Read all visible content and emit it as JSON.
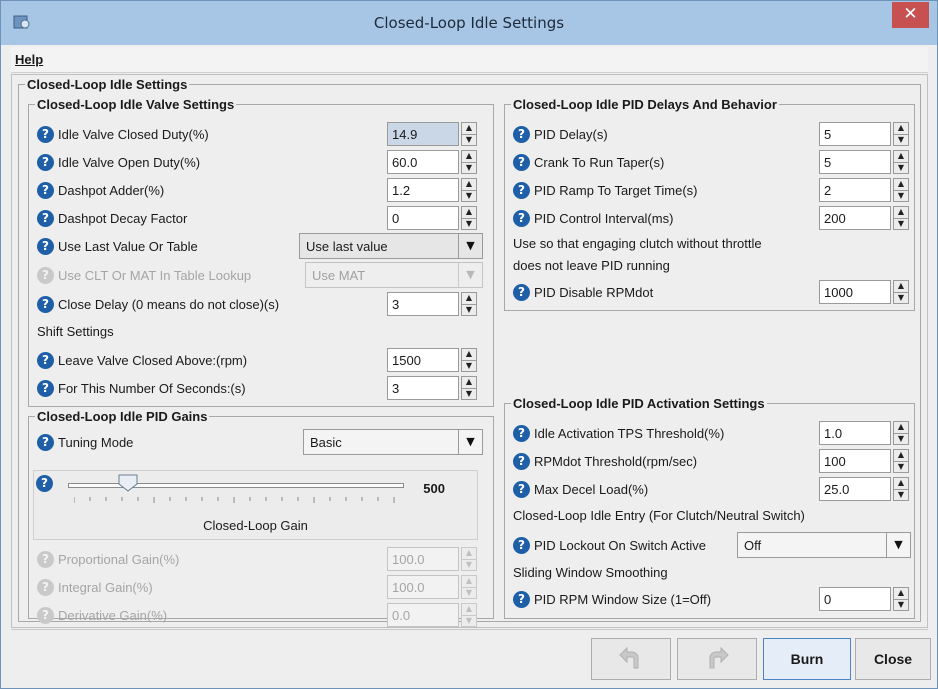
{
  "window": {
    "title": "Closed-Loop Idle Settings",
    "close_glyph": "✕"
  },
  "menu": {
    "help": "Help"
  },
  "outer_group": {
    "title": "Closed-Loop Idle Settings"
  },
  "valve": {
    "title": "Closed-Loop Idle Valve Settings",
    "closed_duty_label": "Idle Valve Closed Duty(%)",
    "closed_duty_value": "14.9",
    "open_duty_label": "Idle Valve Open Duty(%)",
    "open_duty_value": "60.0",
    "dashpot_adder_label": "Dashpot Adder(%)",
    "dashpot_adder_value": "1.2",
    "dashpot_decay_label": "Dashpot Decay Factor",
    "dashpot_decay_value": "0",
    "use_last_label": "Use Last Value Or Table",
    "use_last_value": "Use last value",
    "clt_mat_label": "Use CLT Or MAT In Table Lookup",
    "clt_mat_value": "Use MAT",
    "close_delay_label": "Close Delay (0 means do not close)(s)",
    "close_delay_value": "3",
    "shift_settings": "Shift Settings",
    "leave_closed_label": "Leave Valve Closed Above:(rpm)",
    "leave_closed_value": "1500",
    "seconds_label": "For This Number Of Seconds:(s)",
    "seconds_value": "3"
  },
  "gains": {
    "title": "Closed-Loop Idle PID Gains",
    "tuning_mode_label": "Tuning Mode",
    "tuning_mode_value": "Basic",
    "slider_value": "500",
    "slider_caption": "Closed-Loop Gain",
    "slider_position": 0.18,
    "proportional_label": "Proportional Gain(%)",
    "proportional_value": "100.0",
    "integral_label": "Integral Gain(%)",
    "integral_value": "100.0",
    "derivative_label": "Derivative Gain(%)",
    "derivative_value": "0.0"
  },
  "delays": {
    "title": "Closed-Loop Idle PID Delays And Behavior",
    "pid_delay_label": "PID Delay(s)",
    "pid_delay_value": "5",
    "crank_taper_label": "Crank To Run Taper(s)",
    "crank_taper_value": "5",
    "ramp_label": "PID Ramp To Target Time(s)",
    "ramp_value": "2",
    "interval_label": "PID Control Interval(ms)",
    "interval_value": "200",
    "note_line1": "Use so that engaging clutch without throttle",
    "note_line2": "does not leave PID running",
    "rpmdot_disable_label": "PID Disable RPMdot",
    "rpmdot_disable_value": "1000"
  },
  "activation": {
    "title": "Closed-Loop Idle PID Activation Settings",
    "tps_label": "Idle Activation TPS Threshold(%)",
    "tps_value": "1.0",
    "rpmdot_label": "RPMdot Threshold(rpm/sec)",
    "rpmdot_value": "100",
    "decel_label": "Max Decel Load(%)",
    "decel_value": "25.0",
    "entry_text": "Closed-Loop Idle Entry (For Clutch/Neutral Switch)",
    "lockout_label": "PID Lockout On Switch Active",
    "lockout_value": "Off",
    "smoothing_text": "Sliding Window Smoothing",
    "window_label": "PID RPM Window Size (1=Off)",
    "window_value": "0"
  },
  "buttons": {
    "burn": "Burn",
    "close": "Close"
  },
  "icons": {
    "help": "?",
    "spin_up": "▲",
    "spin_down": "▼",
    "dropdown": "▼"
  }
}
